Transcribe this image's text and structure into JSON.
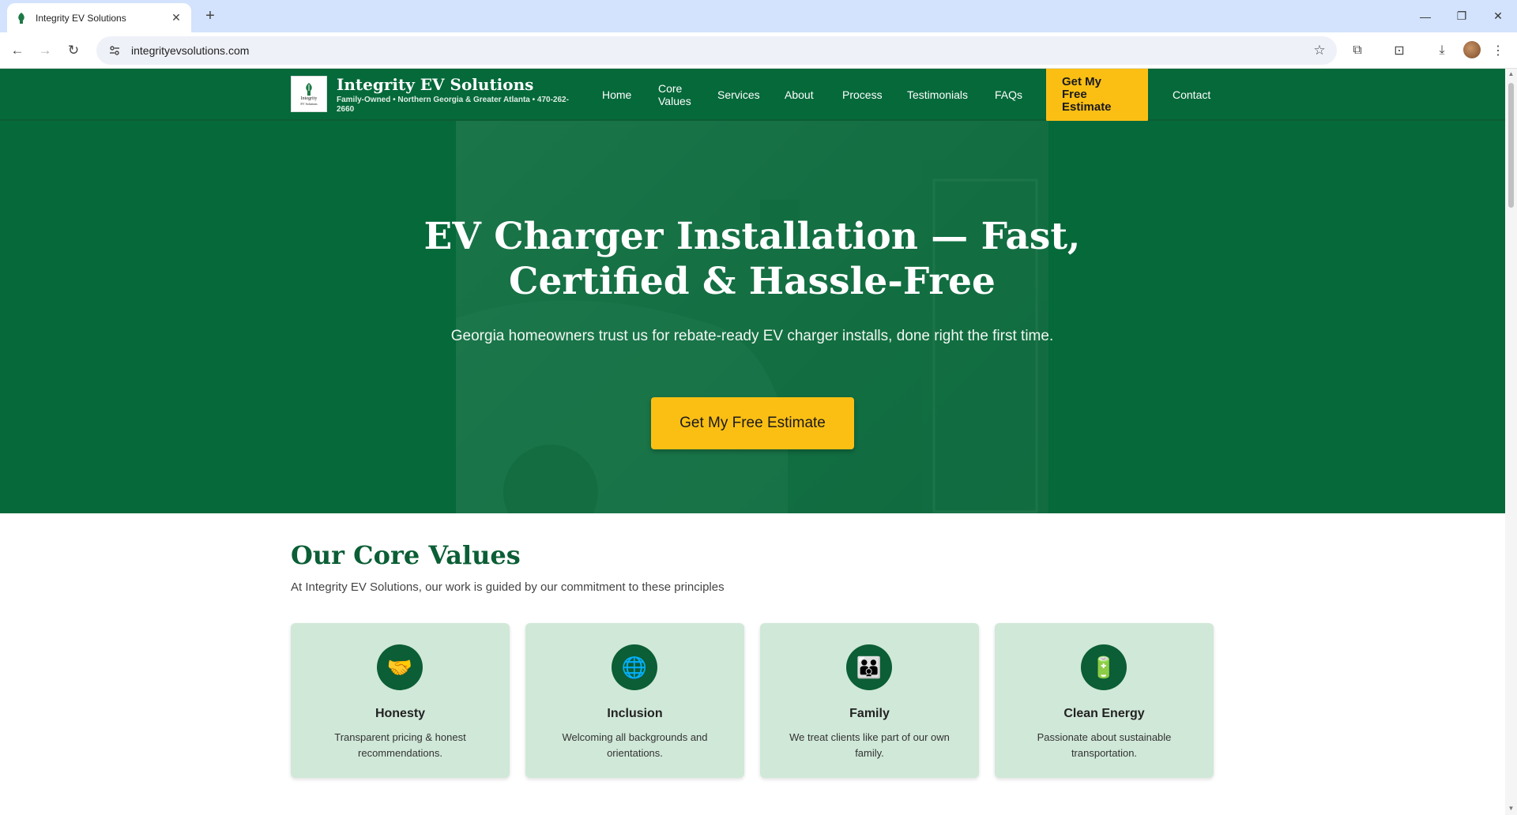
{
  "browser": {
    "tab_title": "Integrity EV Solutions",
    "url": "integrityevsolutions.com"
  },
  "header": {
    "brand_name": "Integrity EV Solutions",
    "tagline": "Family-Owned • Northern Georgia & Greater Atlanta • 470-262-2660",
    "logo_text_1": "Integrity",
    "logo_text_2": "EV Solutions",
    "nav": {
      "home": "Home",
      "core_values_1": "Core",
      "core_values_2": "Values",
      "services": "Services",
      "about": "About",
      "process": "Process",
      "testimonials": "Testimonials",
      "faqs": "FAQs",
      "cta_1": "Get My",
      "cta_2": "Free",
      "cta_3": "Estimate",
      "contact": "Contact"
    }
  },
  "hero": {
    "title_line_1": "EV Charger Installation — Fast,",
    "title_line_2": "Certified & Hassle-Free",
    "subtitle": "Georgia homeowners trust us for rebate-ready EV charger installs, done right the first time.",
    "cta": "Get My Free Estimate"
  },
  "core_values": {
    "title": "Our Core Values",
    "subtitle": "At Integrity EV Solutions, our work is guided by our commitment to these principles",
    "cards": [
      {
        "name": "Honesty",
        "desc": "Transparent pricing & honest recommendations.",
        "icon": "handshake-icon",
        "glyph": "🤝"
      },
      {
        "name": "Inclusion",
        "desc": "Welcoming all backgrounds and orientations.",
        "icon": "globe-icon",
        "glyph": "🌐"
      },
      {
        "name": "Family",
        "desc": "We treat clients like part of our own family.",
        "icon": "family-icon",
        "glyph": "👪"
      },
      {
        "name": "Clean Energy",
        "desc": "Passionate about sustainable transportation.",
        "icon": "battery-icon",
        "glyph": "🔋"
      }
    ]
  },
  "colors": {
    "brand_green": "#05693a",
    "accent_yellow": "#fbbf14",
    "card_bg": "#d0e8d8"
  }
}
